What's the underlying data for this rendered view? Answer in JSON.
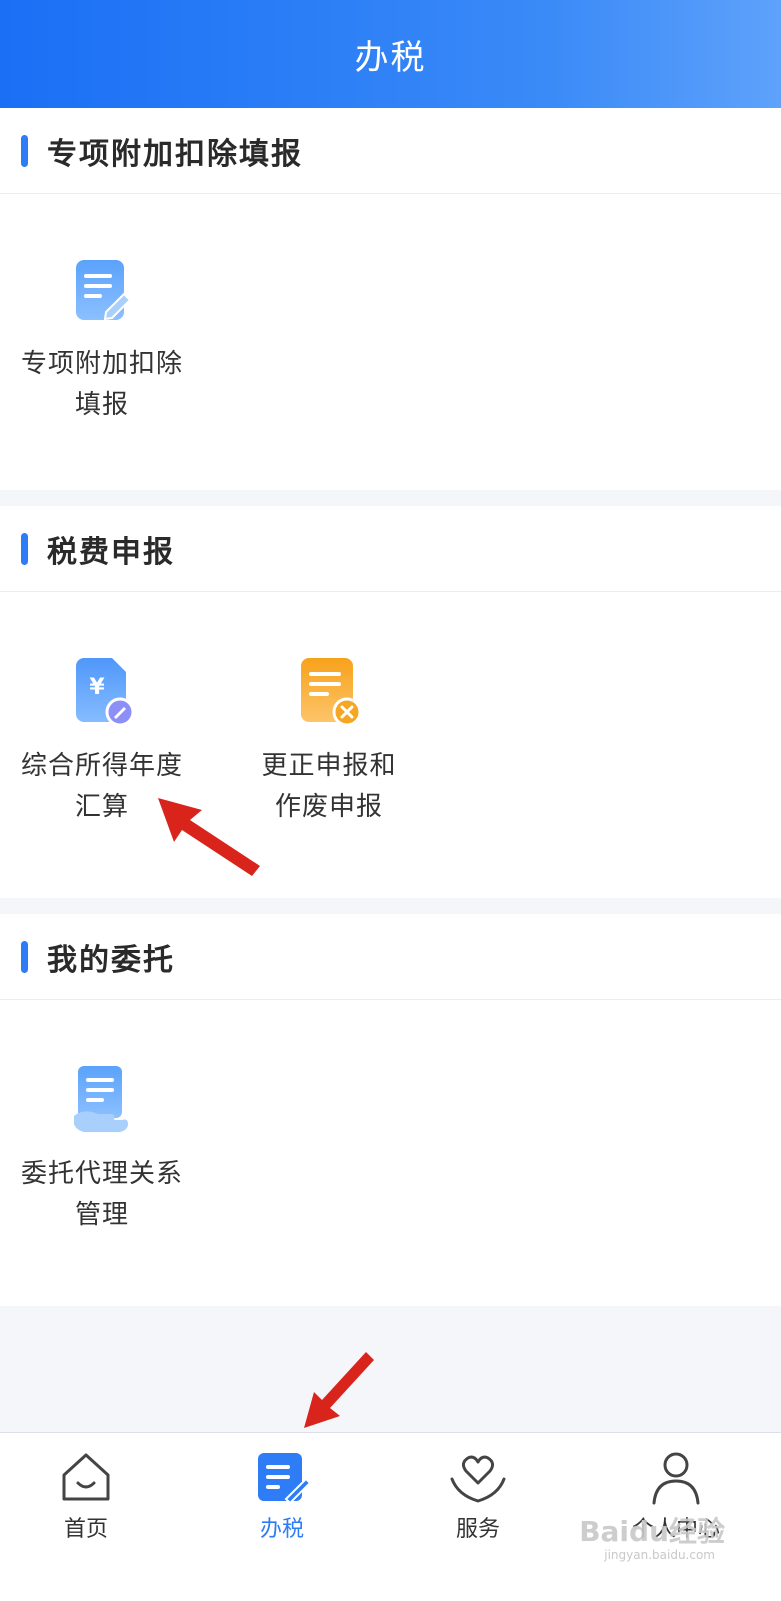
{
  "header": {
    "title": "办税"
  },
  "sections": [
    {
      "title": "专项附加扣除填报",
      "items": [
        {
          "line1": "专项附加扣除",
          "line2": "填报",
          "icon": "document-edit-icon"
        }
      ]
    },
    {
      "title": "税费申报",
      "items": [
        {
          "line1": "综合所得年度",
          "line2": "汇算",
          "icon": "yuan-document-icon"
        },
        {
          "line1": "更正申报和",
          "line2": "作废申报",
          "icon": "document-cancel-icon"
        }
      ]
    },
    {
      "title": "我的委托",
      "items": [
        {
          "line1": "委托代理关系",
          "line2": "管理",
          "icon": "document-hand-icon"
        }
      ]
    }
  ],
  "tabs": [
    {
      "label": "首页",
      "icon": "home-icon",
      "active": false
    },
    {
      "label": "办税",
      "icon": "tax-edit-icon",
      "active": true
    },
    {
      "label": "服务",
      "icon": "heart-hands-icon",
      "active": false
    },
    {
      "label": "个人中心",
      "icon": "user-icon",
      "active": false
    }
  ],
  "watermark": {
    "text": "Baidu经验",
    "sub": "jingyan.baidu.com"
  },
  "colors": {
    "accent": "#2f7df6",
    "header_start": "#1a6ff5",
    "header_end": "#5ea2fb",
    "arrow": "#d9241c"
  }
}
